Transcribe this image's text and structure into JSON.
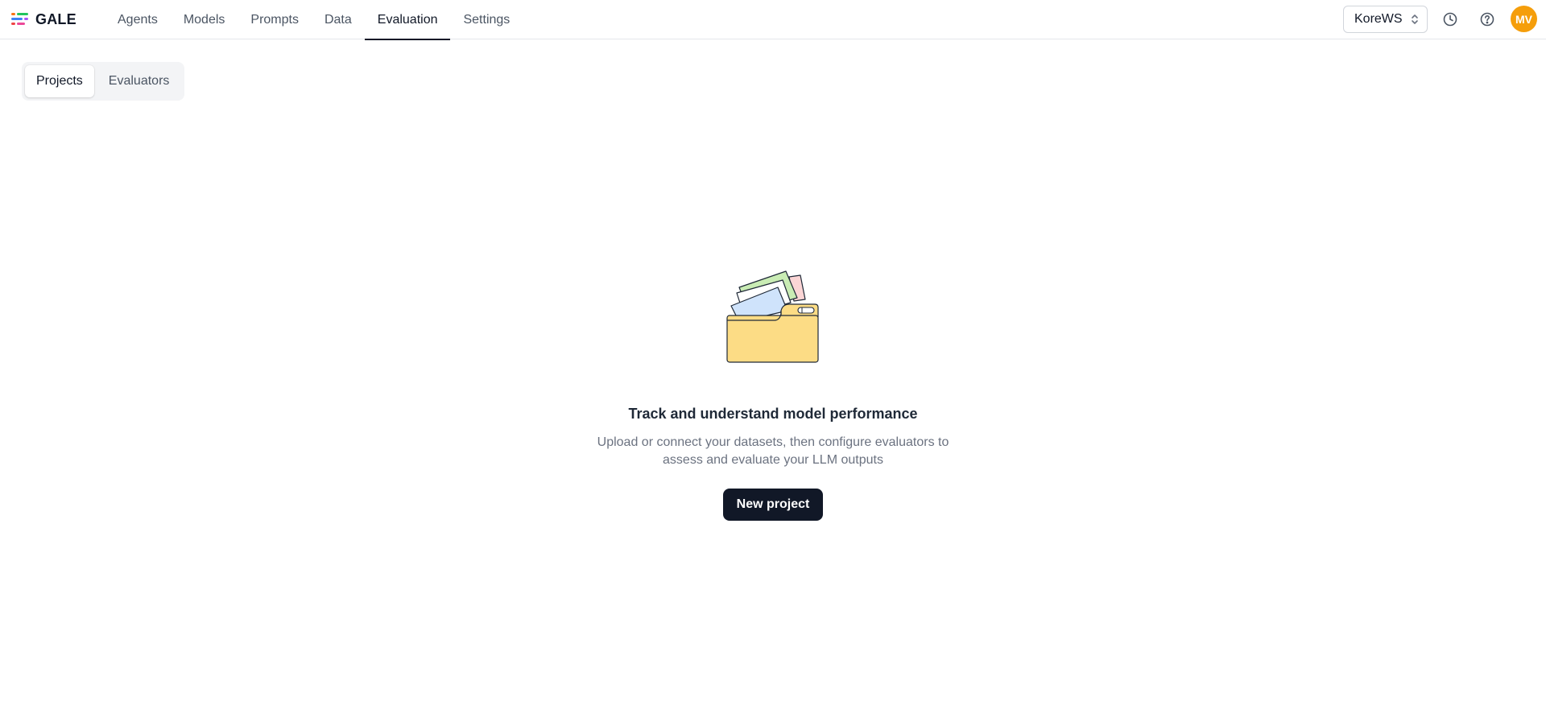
{
  "brand": {
    "name": "GALE",
    "logo_icon": "gale-logo-icon"
  },
  "nav": {
    "items": [
      {
        "label": "Agents"
      },
      {
        "label": "Models"
      },
      {
        "label": "Prompts"
      },
      {
        "label": "Data"
      },
      {
        "label": "Evaluation"
      },
      {
        "label": "Settings"
      }
    ],
    "active": "Evaluation"
  },
  "header": {
    "workspace": {
      "value": "KoreWS",
      "icon": "chevron-up-down-icon"
    },
    "history_icon": "clock-icon",
    "help_icon": "question-circle-icon",
    "avatar": {
      "initials": "MV",
      "color": "#f59e0b"
    }
  },
  "tabs": {
    "items": [
      {
        "label": "Projects"
      },
      {
        "label": "Evaluators"
      }
    ],
    "active": "Projects"
  },
  "empty_state": {
    "illustration": "folder-with-documents-icon",
    "title": "Track and understand model performance",
    "description": "Upload or connect your datasets, then configure evaluators to assess and evaluate your LLM outputs",
    "button_label": "New project"
  },
  "colors": {
    "primary_button": "#111827",
    "avatar": "#f59e0b",
    "active_tab_underline": "#111827",
    "folder": "#fcdc85"
  }
}
